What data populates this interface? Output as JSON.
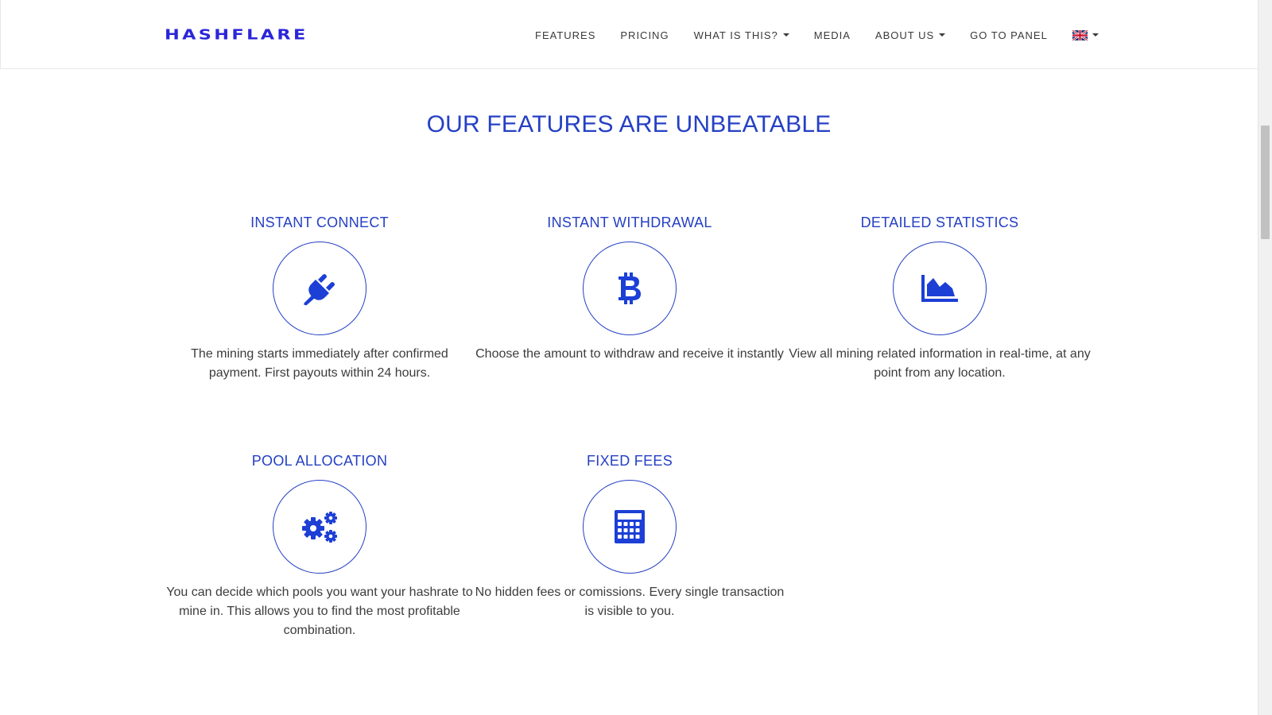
{
  "header": {
    "logo_text": "HASHFLARE",
    "nav": [
      {
        "label": "FEATURES",
        "dropdown": false
      },
      {
        "label": "PRICING",
        "dropdown": false
      },
      {
        "label": "WHAT IS THIS?",
        "dropdown": true
      },
      {
        "label": "MEDIA",
        "dropdown": false
      },
      {
        "label": "ABOUT US",
        "dropdown": true
      },
      {
        "label": "GO TO PANEL",
        "dropdown": false
      }
    ],
    "language_icon": "uk-flag-icon"
  },
  "section": {
    "title": "OUR FEATURES ARE UNBEATABLE"
  },
  "features": [
    {
      "title": "INSTANT CONNECT",
      "icon": "plug-icon",
      "description": "The mining starts immediately after confirmed payment. First payouts within 24 hours."
    },
    {
      "title": "INSTANT WITHDRAWAL",
      "icon": "bitcoin-icon",
      "description": "Choose the amount to withdraw and receive it instantly"
    },
    {
      "title": "DETAILED STATISTICS",
      "icon": "area-chart-icon",
      "description": "View all mining related information in real-time, at any point from any location."
    },
    {
      "title": "POOL ALLOCATION",
      "icon": "gears-icon",
      "description": "You can decide which pools you want your hashrate to mine in. This allows you to find the most profitable combination."
    },
    {
      "title": "FIXED FEES",
      "icon": "calculator-icon",
      "description": "No hidden fees or comissions. Every single transaction is visible to you."
    }
  ],
  "colors": {
    "accent": "#2540c4",
    "logo": "#2b26d8",
    "text": "#3c3c3c"
  }
}
